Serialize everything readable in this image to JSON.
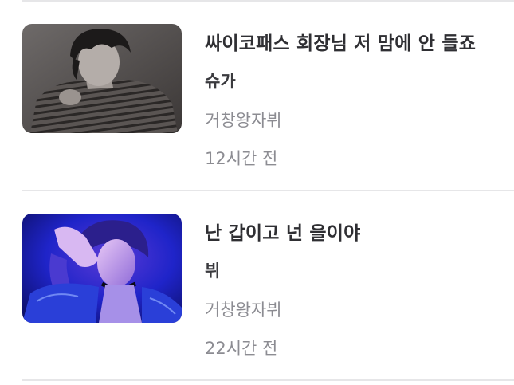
{
  "posts": [
    {
      "title": "싸이코패스 회장님 저 맘에 안 들죠",
      "category": "슈가",
      "author": "거창왕자뷔",
      "time": "12시간 전",
      "thumbnail_icon": "monochrome-portrait-thumbnail"
    },
    {
      "title": "난 갑이고 넌 을이야",
      "category": "뷔",
      "author": "거창왕자뷔",
      "time": "22시간 전",
      "thumbnail_icon": "blue-neon-portrait-thumbnail"
    }
  ],
  "colors": {
    "title": "#2f2f33",
    "meta": "#8c8c92",
    "divider": "#e6e6e8"
  }
}
